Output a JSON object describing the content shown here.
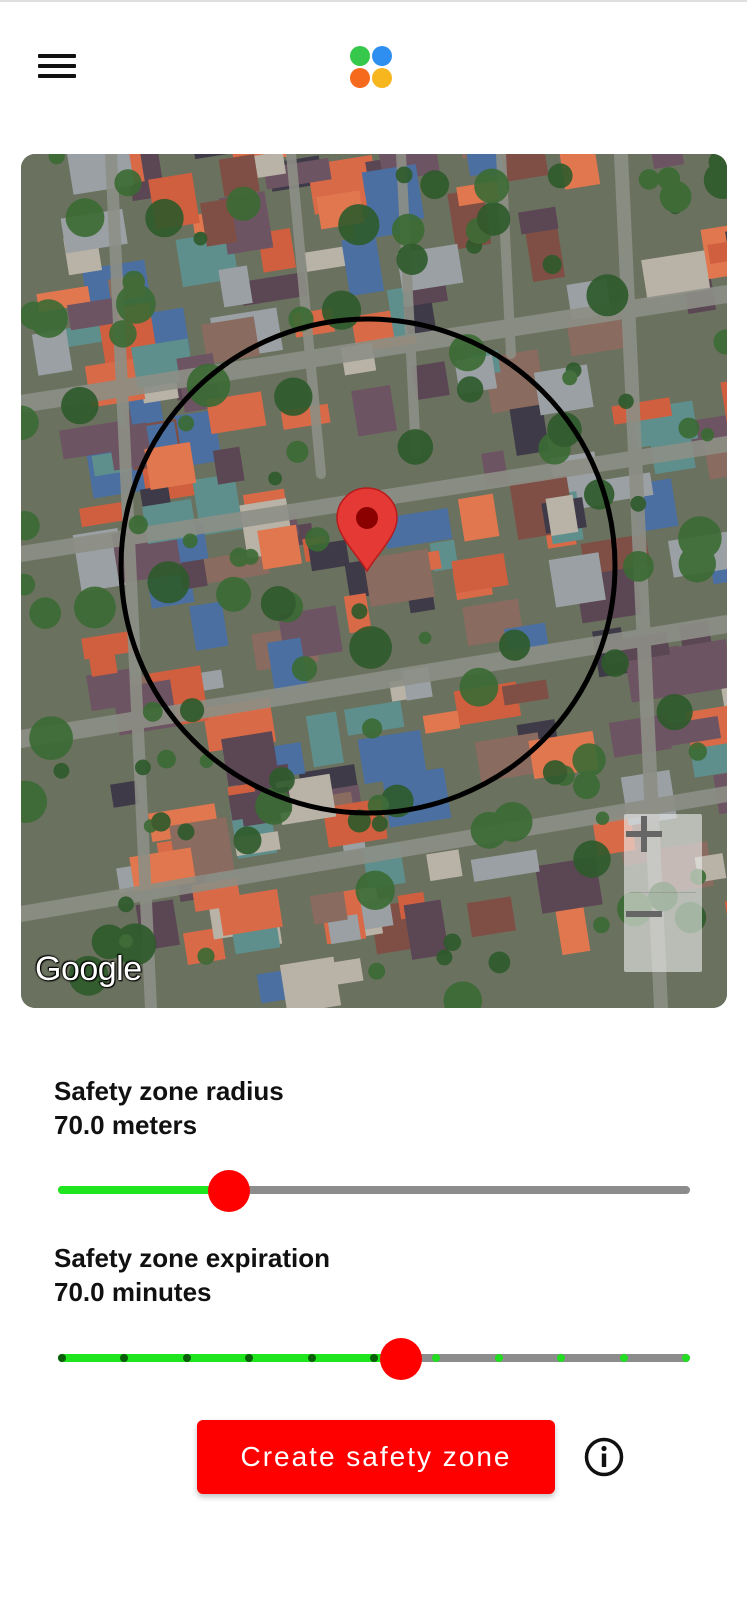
{
  "app": {
    "menu_icon": "hamburger-menu-icon",
    "logo_icon": "four-dots-logo-icon",
    "logo_colors": [
      "#35c84a",
      "#2f8ff0",
      "#f56a1c",
      "#f8b61e"
    ]
  },
  "map": {
    "attribution": "Google",
    "marker_icon": "location-pin-icon",
    "zoom_in_icon": "plus-icon",
    "zoom_out_icon": "minus-icon",
    "zone_circle_color": "#000000",
    "marker_color": "#e53935"
  },
  "radius": {
    "title": "Safety zone radius",
    "value_text": "70.0 meters",
    "value": 70.0,
    "fraction": 0.27
  },
  "expiration": {
    "title": "Safety zone expiration",
    "value_text": "70.0 minutes",
    "value": 70.0,
    "fraction": 0.543,
    "steps": 11
  },
  "actions": {
    "create_label": "Create safety zone",
    "info_icon": "info-icon"
  },
  "colors": {
    "accent": "#ff0000",
    "slider_active": "#1ee51e",
    "slider_inactive": "#8c8c8c"
  }
}
